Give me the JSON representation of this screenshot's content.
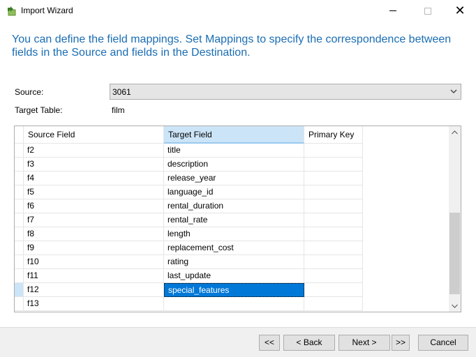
{
  "window": {
    "title": "Import Wizard",
    "icon": "import-arrow-icon"
  },
  "instruction": "You can define the field mappings. Set Mappings to specify the correspondence between fields in the Source and fields in the Destination.",
  "form": {
    "source_label": "Source:",
    "source_value": "3061",
    "target_label": "Target Table:",
    "target_value": "film"
  },
  "grid": {
    "columns": [
      "Source Field",
      "Target Field",
      "Primary Key"
    ],
    "rows": [
      {
        "source": "f2",
        "target": "title",
        "primary_key": ""
      },
      {
        "source": "f3",
        "target": "description",
        "primary_key": ""
      },
      {
        "source": "f4",
        "target": "release_year",
        "primary_key": ""
      },
      {
        "source": "f5",
        "target": "language_id",
        "primary_key": ""
      },
      {
        "source": "f6",
        "target": "rental_duration",
        "primary_key": ""
      },
      {
        "source": "f7",
        "target": "rental_rate",
        "primary_key": ""
      },
      {
        "source": "f8",
        "target": "length",
        "primary_key": ""
      },
      {
        "source": "f9",
        "target": "replacement_cost",
        "primary_key": ""
      },
      {
        "source": "f10",
        "target": "rating",
        "primary_key": ""
      },
      {
        "source": "f11",
        "target": "last_update",
        "primary_key": ""
      },
      {
        "source": "f12",
        "target": "special_features",
        "primary_key": "",
        "selected": true
      },
      {
        "source": "f13",
        "target": "",
        "primary_key": ""
      }
    ]
  },
  "buttons": {
    "first": "<<",
    "back": "< Back",
    "next": "Next >",
    "last": ">>",
    "cancel": "Cancel"
  },
  "colors": {
    "accent": "#1a6db3",
    "selection": "#0078d7",
    "header_highlight": "#cce4f7"
  }
}
